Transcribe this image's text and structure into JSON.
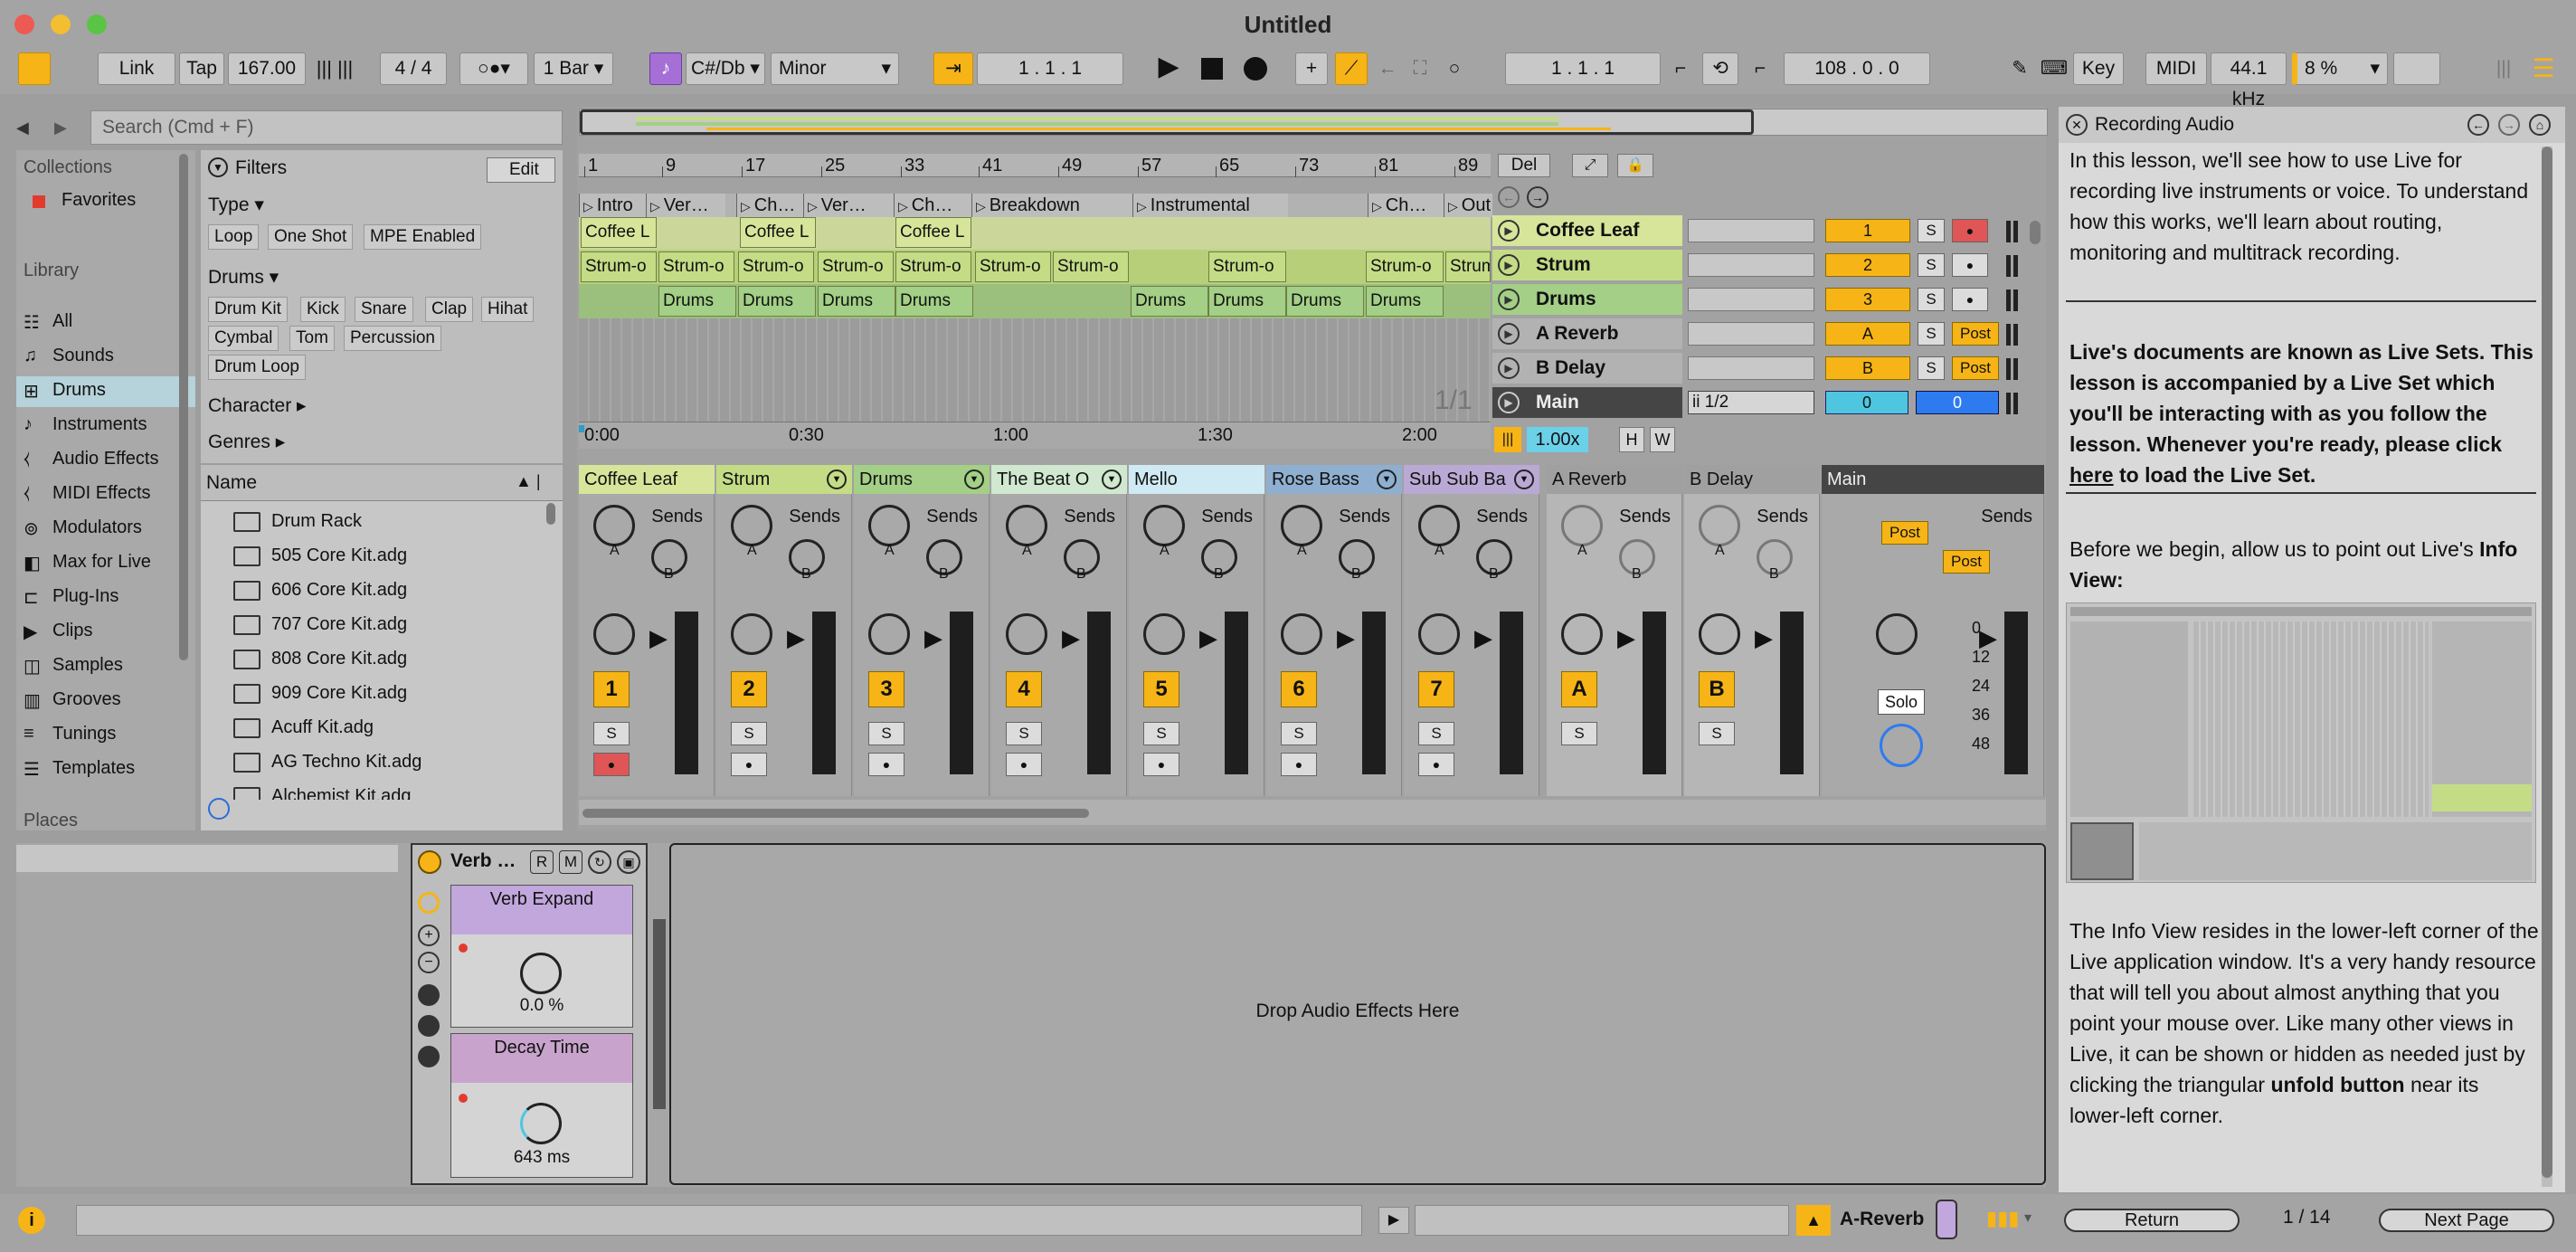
{
  "window": {
    "title": "Untitled"
  },
  "controls": {
    "link": "Link",
    "tap": "Tap",
    "tempo": "167.00",
    "meter": "4 / 4",
    "quantize": "1 Bar",
    "key": "C#/Db",
    "scale": "Minor",
    "arr_position": "1 .  1 .  1",
    "loop_start": "1 .  1 .  1",
    "loop_length": "108 .  0 .  0",
    "key_map": "Key",
    "midi_map": "MIDI",
    "sample_rate": "44.1 kHz",
    "cpu": "8 %"
  },
  "browser": {
    "search_placeholder": "Search (Cmd + F)",
    "collections_label": "Collections",
    "favorites": "Favorites",
    "library_label": "Library",
    "library_items": [
      "All",
      "Sounds",
      "Drums",
      "Instruments",
      "Audio Effects",
      "MIDI Effects",
      "Modulators",
      "Max for Live",
      "Plug-Ins",
      "Clips",
      "Samples",
      "Grooves",
      "Tunings",
      "Templates"
    ],
    "places_label": "Places",
    "filters_label": "Filters",
    "edit_label": "Edit",
    "type_label": "Type",
    "type_tags": [
      "Loop",
      "One Shot",
      "MPE Enabled"
    ],
    "drums_label": "Drums",
    "drum_tags": [
      "Drum Kit",
      "Kick",
      "Snare",
      "Clap",
      "Hihat",
      "Cymbal",
      "Tom",
      "Percussion",
      "Drum Loop"
    ],
    "character_label": "Character",
    "genres_label": "Genres",
    "name_header": "Name",
    "files": [
      "Drum Rack",
      "505 Core Kit.adg",
      "606 Core Kit.adg",
      "707 Core Kit.adg",
      "808 Core Kit.adg",
      "909 Core Kit.adg",
      "Acuff Kit.adg",
      "AG Techno Kit.adg",
      "Alchemist Kit.adg"
    ]
  },
  "arrangement": {
    "bars": [
      "1",
      "9",
      "17",
      "25",
      "33",
      "41",
      "49",
      "57",
      "65",
      "73",
      "81",
      "89"
    ],
    "locators": [
      "Intro",
      "Ver…",
      "Ch…",
      "Ver…",
      "Ch…",
      "Breakdown",
      "Instrumental",
      "Ch…",
      "Out"
    ],
    "times": [
      "0:00",
      "0:30",
      "1:00",
      "1:30",
      "2:00"
    ],
    "del": "Del",
    "page": "1/1",
    "zoom": "1.00x",
    "h": "H",
    "w": "W",
    "clip_coffee": "Coffee L",
    "clip_strum": "Strum-o",
    "clip_drums": "Drums",
    "tracks": [
      {
        "name": "Coffee Leaf",
        "num": "1",
        "color": "#d6e59a"
      },
      {
        "name": "Strum",
        "num": "2",
        "color": "#c4dc86"
      },
      {
        "name": "Drums",
        "num": "3",
        "color": "#a3cf86"
      },
      {
        "name": "A Reverb",
        "num": "A",
        "color": "#a8a8a8"
      },
      {
        "name": "B Delay",
        "num": "B",
        "color": "#a8a8a8"
      },
      {
        "name": "Main",
        "num": "",
        "color": "#4a4a4a"
      }
    ],
    "solo_s": "S",
    "post": "Post",
    "main_routing": "ii 1/2",
    "main_vol_l": "0",
    "main_vol_r": "0"
  },
  "mixer": {
    "channels": [
      {
        "name": "Coffee Leaf",
        "num": "1",
        "color": "#d6e59a"
      },
      {
        "name": "Strum",
        "num": "2",
        "color": "#c4dc86"
      },
      {
        "name": "Drums",
        "num": "3",
        "color": "#a3cf86"
      },
      {
        "name": "The Beat O",
        "num": "4",
        "color": "#cfe8cf"
      },
      {
        "name": "Mello",
        "num": "5",
        "color": "#cfeaf2"
      },
      {
        "name": "Rose Bass",
        "num": "6",
        "color": "#8fafd0"
      },
      {
        "name": "Sub Sub Ba",
        "num": "7",
        "color": "#b9a9d4"
      }
    ],
    "returns": [
      {
        "name": "A Reverb",
        "num": "A"
      },
      {
        "name": "B Delay",
        "num": "B"
      }
    ],
    "main_name": "Main",
    "sends": "Sends",
    "knob_a": "A",
    "knob_b": "B",
    "s": "S",
    "solo": "Solo",
    "db_scale": [
      "0",
      "12",
      "24",
      "36",
      "48"
    ],
    "post": "Post"
  },
  "device": {
    "rack_name": "Verb …",
    "macro1_name": "Verb Expand",
    "macro1_value": "0.0 %",
    "macro2_name": "Decay Time",
    "macro2_value": "643 ms",
    "r": "R",
    "m": "M",
    "drop_hint": "Drop Audio Effects Here"
  },
  "status": {
    "selected_track": "A-Reverb"
  },
  "help": {
    "title": "Recording Audio",
    "p1": "In this lesson, we'll see how to use Live for recording live instruments or voice. To understand how this works, we'll learn about routing, monitoring and multitrack recording.",
    "p2a": "Live's documents are known as Live Sets. This lesson is accompanied by a Live Set which you'll be interacting with as you follow the lesson. Whenever you're ready, please click ",
    "p2_link": "here",
    "p2b": " to load the Live Set.",
    "p3a": "Before we begin, allow us to point out Live's ",
    "p3b": "Info View:",
    "p4a": "The Info View resides in the lower-left corner of the Live application window. It's a very handy resource that will tell you about almost anything that you point your mouse over. Like many other views in Live, it can be shown or hidden as needed just by clicking the triangular ",
    "p4b": "unfold button",
    "p4c": " near its lower-left corner.",
    "return": "Return",
    "page": "1 / 14",
    "next": "Next Page"
  }
}
